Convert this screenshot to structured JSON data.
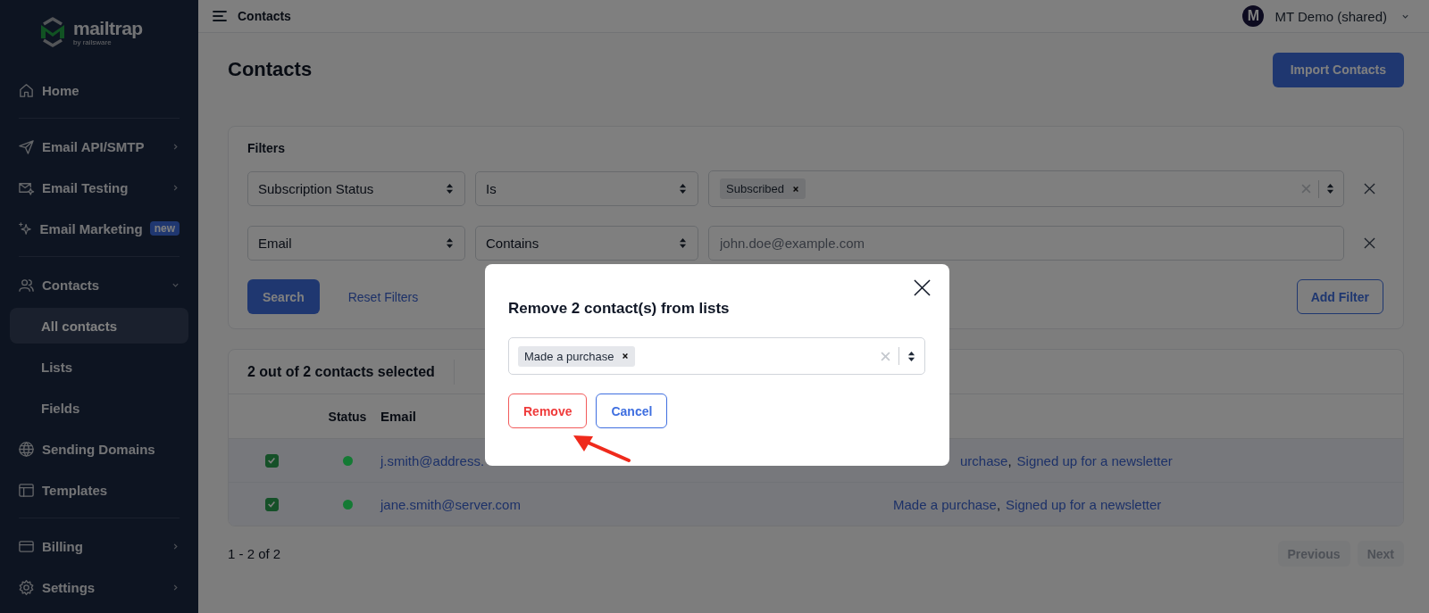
{
  "sidebar": {
    "logo": {
      "name": "mailtrap",
      "tagline": "by railsware"
    },
    "sections": [
      [
        {
          "label": "Home",
          "kind": "home"
        }
      ],
      [
        {
          "label": "Email API/SMTP",
          "kind": "send",
          "expanded": false
        },
        {
          "label": "Email Testing",
          "kind": "mail",
          "expanded": false
        },
        {
          "label": "Email Marketing",
          "kind": "sparkle",
          "badge": "new"
        }
      ],
      [
        {
          "label": "Contacts",
          "kind": "users",
          "expanded": true,
          "children": [
            {
              "label": "All contacts",
              "selected": true
            },
            {
              "label": "Lists",
              "selected": false
            },
            {
              "label": "Fields",
              "selected": false
            }
          ]
        },
        {
          "label": "Sending Domains",
          "kind": "globe"
        },
        {
          "label": "Templates",
          "kind": "layout"
        }
      ],
      [
        {
          "label": "Billing",
          "kind": "card",
          "expanded": false
        },
        {
          "label": "Settings",
          "kind": "gear",
          "expanded": false
        }
      ]
    ]
  },
  "topbar": {
    "title": "Contacts",
    "account": {
      "initial": "M",
      "name": "MT Demo (shared)"
    }
  },
  "page": {
    "title": "Contacts",
    "import_button": "Import Contacts"
  },
  "filters": {
    "title": "Filters",
    "rows": [
      {
        "field": "Subscription Status",
        "operator": "Is",
        "kind": "tags",
        "tags": [
          "Subscribed"
        ]
      },
      {
        "field": "Email",
        "operator": "Contains",
        "kind": "text",
        "placeholder": "john.doe@example.com"
      }
    ],
    "search_button": "Search",
    "reset_link": "Reset Filters",
    "add_button": "Add Filter"
  },
  "table": {
    "selection_summary": "2 out of 2 contacts selected",
    "columns": [
      "Status",
      "Email"
    ],
    "rows": [
      {
        "checked": true,
        "color": "#147a34",
        "email": "j.smith@address.",
        "lists_covered": true,
        "lists": [
          "urchase",
          "Signed up for a newsletter"
        ],
        "list_separators": [
          ","
        ]
      },
      {
        "checked": true,
        "color": "#147a34",
        "email": "jane.smith@server.com",
        "lists_covered": false,
        "lists": [
          "Made a purchase",
          "Signed up for a newsletter"
        ],
        "list_separators": [
          ","
        ]
      }
    ]
  },
  "pagination": {
    "range": "1 - 2 of 2",
    "previous": {
      "label": "Previous",
      "disabled": true
    },
    "next": {
      "label": "Next",
      "disabled": true
    }
  },
  "modal": {
    "title": "Remove 2 contact(s) from lists",
    "tags": [
      "Made a purchase"
    ],
    "remove_button": "Remove",
    "cancel_button": "Cancel"
  }
}
